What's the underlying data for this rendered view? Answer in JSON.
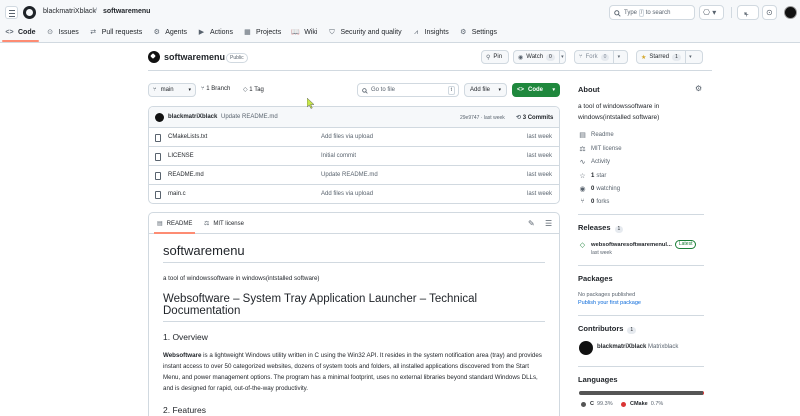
{
  "header": {
    "owner": "blackmatriXblack",
    "separator": "/",
    "repo": "softwaremenu",
    "search_prefix": "Type",
    "search_key": "/",
    "search_suffix": "to search",
    "plus_label": "+",
    "plus_caret": "▾"
  },
  "nav": [
    {
      "icon": "code-icon",
      "glyph": "<>",
      "label": "Code"
    },
    {
      "icon": "issues-icon",
      "glyph": "⊙",
      "label": "Issues"
    },
    {
      "icon": "pull-request-icon",
      "glyph": "⇄",
      "label": "Pull requests"
    },
    {
      "icon": "agents-icon",
      "glyph": "⚙",
      "label": "Agents"
    },
    {
      "icon": "actions-icon",
      "glyph": "▶",
      "label": "Actions"
    },
    {
      "icon": "projects-icon",
      "glyph": "▦",
      "label": "Projects"
    },
    {
      "icon": "wiki-icon",
      "glyph": "📖",
      "label": "Wiki"
    },
    {
      "icon": "security-icon",
      "glyph": "⛉",
      "label": "Security and quality"
    },
    {
      "icon": "insights-icon",
      "glyph": "⩘",
      "label": "Insights"
    },
    {
      "icon": "settings-icon",
      "glyph": "⚙",
      "label": "Settings"
    }
  ],
  "repo_header": {
    "name": "softwaremenu",
    "visibility": "Public",
    "pin_label": "Pin",
    "watch_label": "Watch",
    "watch_count": "0",
    "fork_label": "Fork",
    "fork_count": "0",
    "star_label": "Starred",
    "star_count": "1"
  },
  "toolbar": {
    "branch": "main",
    "branches": "1 Branch",
    "tags": "1 Tag",
    "goto_placeholder": "Go to file",
    "goto_key": "t",
    "add_file": "Add file",
    "code": "Code"
  },
  "commit": {
    "author": "blackmatriXblack",
    "message": "Update README.md",
    "meta": "29e9747 · last week",
    "count": "3 Commits"
  },
  "files": [
    {
      "name": "CMakeLists.txt",
      "message": "Add files via upload",
      "date": "last week"
    },
    {
      "name": "LICENSE",
      "message": "Initial commit",
      "date": "last week"
    },
    {
      "name": "README.md",
      "message": "Update README.md",
      "date": "last week"
    },
    {
      "name": "main.c",
      "message": "Add files via upload",
      "date": "last week"
    }
  ],
  "readme": {
    "tab_readme": "README",
    "tab_license": "MIT license",
    "title": "softwaremenu",
    "tagline": "a tool of windowssoftware in windows(intstalled software)",
    "h2": "Websoftware – System Tray Application Launcher – Technical Documentation",
    "h3_overview": "1. Overview",
    "overview_bold": "Websoftware",
    "overview_text": " is a lightweight Windows utility written in C using the Win32 API. It resides in the system notification area (tray) and provides instant access to over 50 categorized websites, dozens of system tools and folders, all installed applications discovered from the Start Menu, and power management options. The program has a minimal footprint, uses no external libraries beyond standard Windows DLLs, and is designed for rapid, out-of-the-way productivity.",
    "h3_features": "2. Features"
  },
  "sidebar": {
    "about_title": "About",
    "description": "a tool of windowssoftware in windows(intstalled software)",
    "readme": "Readme",
    "license": "MIT license",
    "activity": "Activity",
    "stars_n": "1",
    "stars": "star",
    "watching_n": "0",
    "watching": "watching",
    "forks_n": "0",
    "forks": "forks",
    "releases_title": "Releases",
    "releases_count": "1",
    "release_name": "websoftwaresoftwaremenul...",
    "release_badge": "Latest",
    "release_date": "last week",
    "packages_title": "Packages",
    "packages_text": "No packages published",
    "packages_link": "Publish your first package",
    "contributors_title": "Contributors",
    "contributors_count": "1",
    "contributor_login": "blackmatriXblack",
    "contributor_name": "Matrixblack",
    "languages_title": "Languages",
    "lang1": "C",
    "lang1_pct": "99.3%",
    "lang2": "CMake",
    "lang2_pct": "0.7%",
    "lang1_value": 99.3,
    "lang2_value": 0.7
  },
  "colors": {
    "accent_green": "#1f883d",
    "tab_underline": "#fd8c73",
    "link": "#0969da",
    "lang_c": "#555555",
    "lang_cmake": "#da3434"
  }
}
